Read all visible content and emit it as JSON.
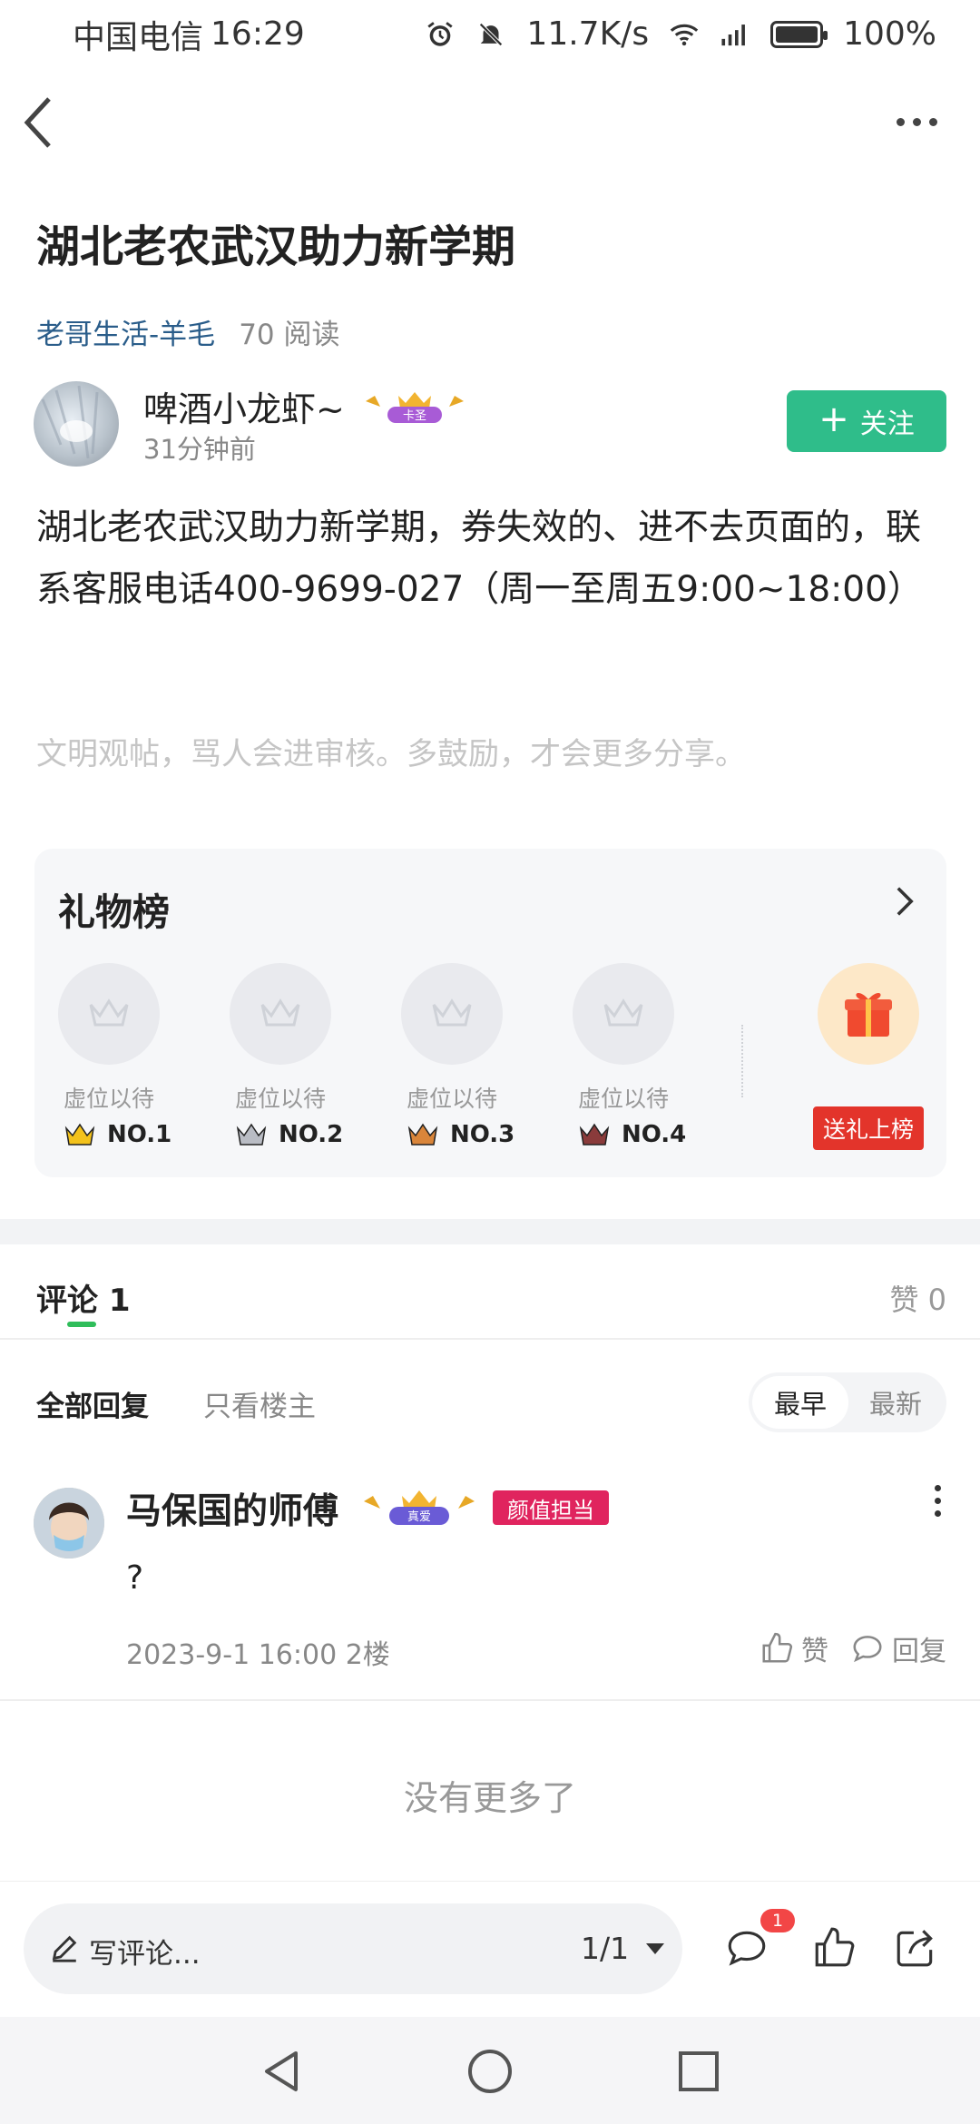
{
  "status_bar": {
    "carrier": "中国电信",
    "time": "16:29",
    "net_speed": "11.7K/s",
    "network": "4G",
    "battery": "100%"
  },
  "article": {
    "title": "湖北老农武汉助力新学期",
    "topic": "老哥生活-羊毛",
    "reads": "70 阅读",
    "author": {
      "name": "啤酒小龙虾~",
      "badge": "卡圣",
      "time": "31分钟前",
      "follow_label": "关注"
    },
    "body": "湖北老农武汉助力新学期，券失效的、进不去页面的，联系客服电话400-9699-027（周一至周五9:00~18:00）",
    "civil_note": "文明观帖，骂人会进审核。多鼓励，才会更多分享。"
  },
  "gift_list": {
    "title": "礼物榜",
    "slots": [
      {
        "label": "虚位以待",
        "rank": "NO.1",
        "crown_color": "#f3c21b"
      },
      {
        "label": "虚位以待",
        "rank": "NO.2",
        "crown_color": "#b9bcc4"
      },
      {
        "label": "虚位以待",
        "rank": "NO.3",
        "crown_color": "#d9853a"
      },
      {
        "label": "虚位以待",
        "rank": "NO.4",
        "crown_color": "#8a3b3b"
      }
    ],
    "send_label": "送礼上榜"
  },
  "comments": {
    "tab_label": "评论 1",
    "likes": "赞 0",
    "filter_all": "全部回复",
    "filter_owner": "只看楼主",
    "sort_earliest": "最早",
    "sort_newest": "最新",
    "items": [
      {
        "name": "马保国的师傅",
        "crown_badge": "真爱",
        "tag": "颜值担当",
        "text": "?",
        "meta": "2023-9-1 16:00  2楼",
        "like_label": "赞",
        "reply_label": "回复"
      }
    ],
    "no_more": "没有更多了"
  },
  "bottom_bar": {
    "placeholder": "写评论...",
    "page": "1/1",
    "comment_badge": "1"
  },
  "colors": {
    "accent_green": "#2fbd8a",
    "gift_red": "#e3342b",
    "tag_pink": "#e0245e",
    "topic_blue": "#2a5d8a"
  }
}
